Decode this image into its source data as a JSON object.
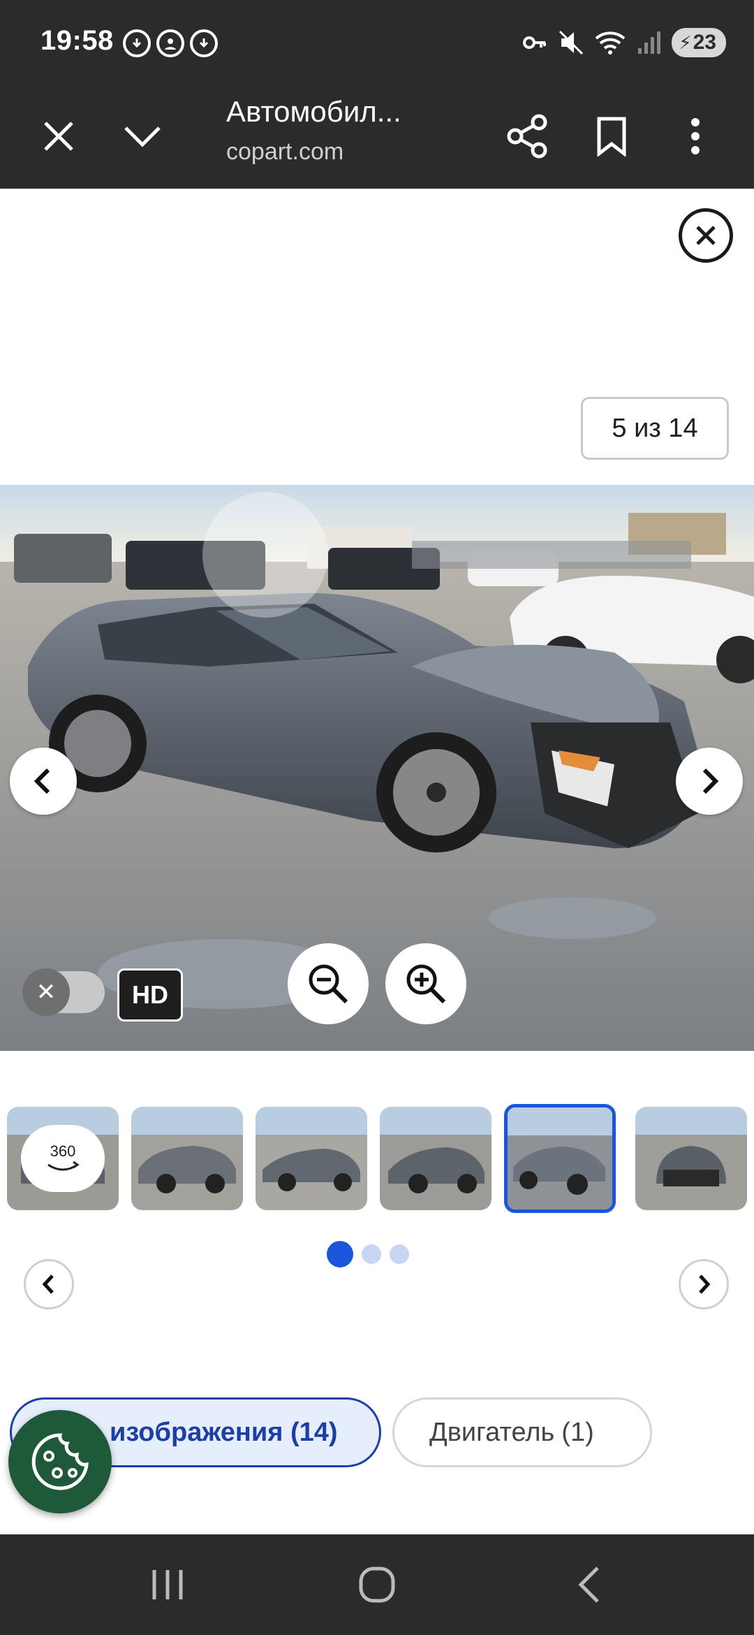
{
  "status_bar": {
    "time": "19:58",
    "battery_level": "23",
    "icons_left": [
      "download-icon",
      "account-icon",
      "download-icon"
    ],
    "icons_right": [
      "key-icon",
      "mute-icon",
      "wifi-icon",
      "signal-icon",
      "battery-icon"
    ]
  },
  "app_bar": {
    "title": "Автомобил...",
    "subtitle": "copart.com",
    "actions": [
      "close-icon",
      "chevron-down-icon",
      "share-icon",
      "bookmark-icon",
      "more-vert-icon"
    ]
  },
  "viewer": {
    "counter": "5 из 14",
    "hd_label": "HD",
    "toggle_off_symbol": "✕",
    "hd_enabled": false
  },
  "thumbnails": {
    "items": [
      {
        "label": "360",
        "is_360": true
      },
      {
        "label": ""
      },
      {
        "label": ""
      },
      {
        "label": ""
      },
      {
        "label": "",
        "active": true
      },
      {
        "label": ""
      }
    ],
    "active_index": 4,
    "pages": 3,
    "active_page": 0
  },
  "chips": {
    "images_label": "изображения (14)",
    "engine_label": "Двигатель",
    "engine_count": "(1)"
  },
  "colors": {
    "bar_bg": "#2b2b2b",
    "accent": "#1a56db",
    "chip_active_text": "#1a3fa8",
    "cookie_fab": "#1e5a3a"
  }
}
